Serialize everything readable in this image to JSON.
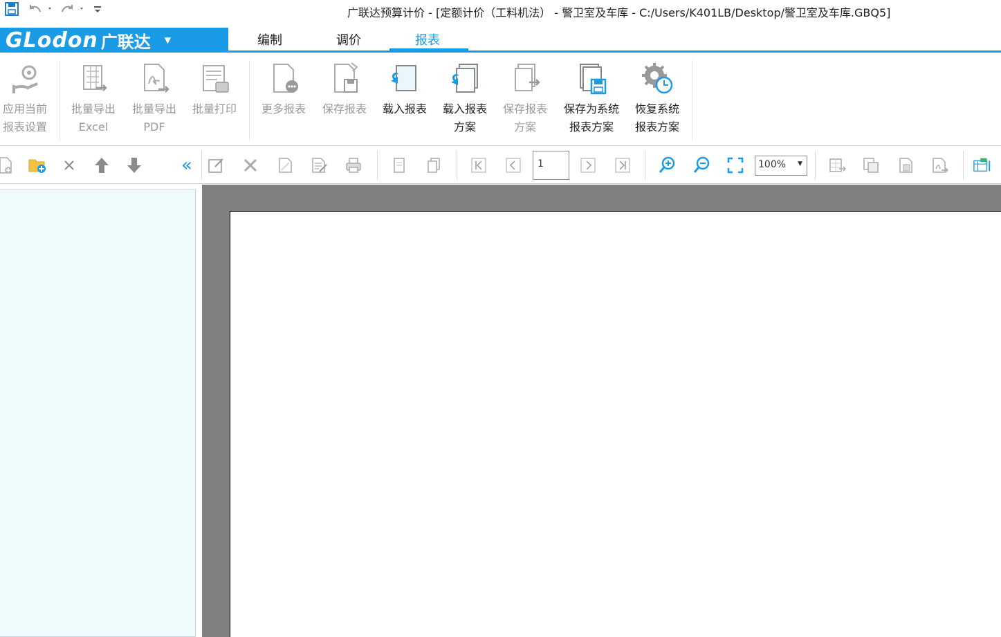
{
  "window": {
    "title": "广联达预算计价 - [定额计价（工料机法） - 警卫室及车库 - C:/Users/K401LB/Desktop/警卫室及车库.GBQ5]"
  },
  "app": {
    "brand": "GLodon",
    "brand_cn": "广联达",
    "accent_color": "#1a9be6"
  },
  "tabs": [
    {
      "label": "编制",
      "active": false
    },
    {
      "label": "调价",
      "active": false
    },
    {
      "label": "报表",
      "active": true
    }
  ],
  "ribbon": {
    "apply_report_settings": {
      "line1": "应用当前",
      "line2": "报表设置",
      "enabled": false,
      "icon": "hand-gear-icon"
    },
    "batch_export_excel": {
      "line1": "批量导出",
      "line2": "Excel",
      "enabled": false,
      "icon": "excel-export-icon"
    },
    "batch_export_pdf": {
      "line1": "批量导出",
      "line2": "PDF",
      "enabled": false,
      "icon": "pdf-export-icon"
    },
    "batch_print": {
      "line1": "批量打印",
      "enabled": false,
      "icon": "print-icon"
    },
    "more_reports": {
      "line1": "更多报表",
      "enabled": false,
      "icon": "more-report-icon"
    },
    "save_report": {
      "line1": "保存报表",
      "enabled": false,
      "icon": "save-report-icon"
    },
    "load_report": {
      "line1": "载入报表",
      "enabled": true,
      "icon": "load-report-icon"
    },
    "load_report_scheme": {
      "line1": "载入报表",
      "line2": "方案",
      "enabled": true,
      "icon": "load-scheme-icon"
    },
    "save_report_scheme": {
      "line1": "保存报表",
      "line2": "方案",
      "enabled": false,
      "icon": "save-scheme-icon"
    },
    "save_as_system_scheme": {
      "line1": "保存为系统",
      "line2": "报表方案",
      "enabled": true,
      "icon": "save-system-scheme-icon"
    },
    "restore_system_scheme": {
      "line1": "恢复系统",
      "line2": "报表方案",
      "enabled": true,
      "icon": "restore-system-scheme-icon"
    }
  },
  "toolbar": {
    "page_number": "1",
    "zoom": "100%",
    "collapse_glyph": "«"
  }
}
